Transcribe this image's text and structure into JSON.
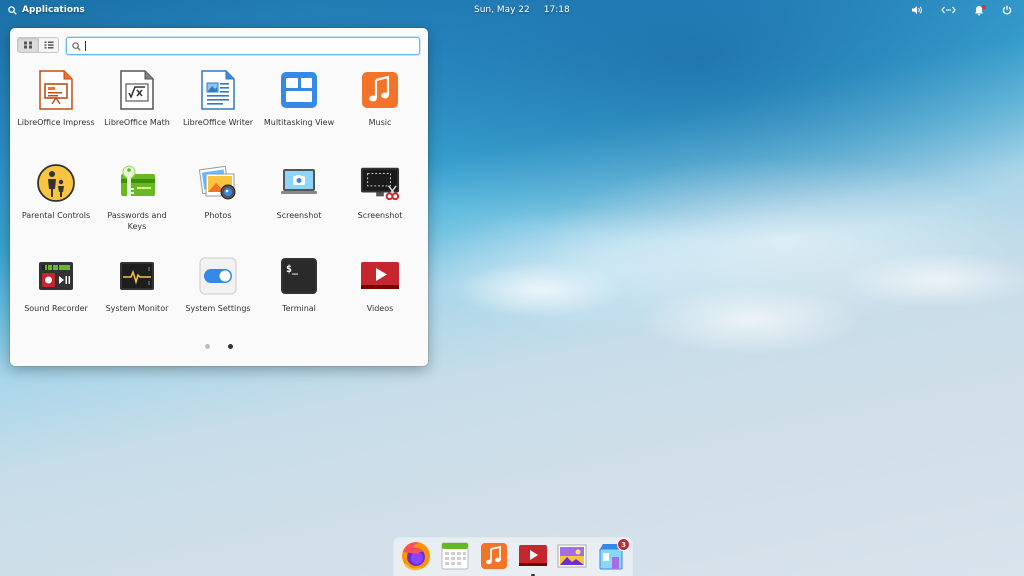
{
  "panel": {
    "applications_label": "Applications",
    "date": "Sun, May 22",
    "time": "17:18"
  },
  "launcher": {
    "search": {
      "value": "",
      "placeholder": ""
    },
    "apps": [
      {
        "label": "LibreOffice Impress",
        "icon": "libreoffice-impress-icon"
      },
      {
        "label": "LibreOffice Math",
        "icon": "libreoffice-math-icon"
      },
      {
        "label": "LibreOffice Writer",
        "icon": "libreoffice-writer-icon"
      },
      {
        "label": "Multitasking View",
        "icon": "multitasking-view-icon"
      },
      {
        "label": "Music",
        "icon": "music-icon"
      },
      {
        "label": "Parental Controls",
        "icon": "parental-controls-icon"
      },
      {
        "label": "Passwords and Keys",
        "icon": "passwords-keys-icon"
      },
      {
        "label": "Photos",
        "icon": "photos-icon"
      },
      {
        "label": "Screenshot",
        "icon": "screenshot-camera-icon"
      },
      {
        "label": "Screenshot",
        "icon": "screenshot-scissors-icon"
      },
      {
        "label": "Sound Recorder",
        "icon": "sound-recorder-icon"
      },
      {
        "label": "System Monitor",
        "icon": "system-monitor-icon"
      },
      {
        "label": "System Settings",
        "icon": "system-settings-icon"
      },
      {
        "label": "Terminal",
        "icon": "terminal-icon"
      },
      {
        "label": "Videos",
        "icon": "videos-icon"
      }
    ],
    "pages": {
      "count": 2,
      "current": 2
    }
  },
  "dock": {
    "items": [
      {
        "name": "firefox",
        "icon": "firefox-icon"
      },
      {
        "name": "calendar",
        "icon": "calendar-icon"
      },
      {
        "name": "music",
        "icon": "music-icon"
      },
      {
        "name": "videos",
        "icon": "videos-icon"
      },
      {
        "name": "photos",
        "icon": "photos-icon"
      },
      {
        "name": "appcenter",
        "icon": "appcenter-icon",
        "badge": "3"
      }
    ]
  },
  "colors": {
    "accent": "#64baff",
    "orange": "#f37329",
    "red": "#c6262e",
    "blue": "#3689e6",
    "dark": "#333333"
  }
}
